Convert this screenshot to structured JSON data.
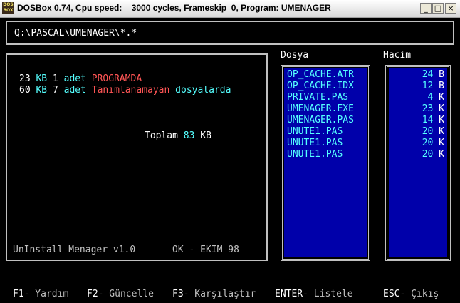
{
  "window": {
    "title": "DOSBox 0.74, Cpu speed:    3000 cycles, Frameskip  0, Program: UMENAGER",
    "icon_text": "DOS BOX",
    "min": "_",
    "max": "□",
    "close": "×"
  },
  "path": "Q:\\PASCAL\\UMENAGER\\*.*",
  "summary": {
    "line1": {
      "size": "23",
      "unit": "KB",
      "count": "1",
      "adet": "adet",
      "label": "PROGRAMDA"
    },
    "line2": {
      "size": "60",
      "unit": "KB",
      "count": "7",
      "adet": "adet",
      "label": "Tanımlanamayan",
      "suffix": "dosyalarda"
    },
    "total": {
      "label": "Toplam",
      "value": "83",
      "unit": "KB"
    },
    "footer_app": "UnInstall Menager v1.0",
    "footer_date": "OK - EKIM 98"
  },
  "headers": {
    "files": "Dosya",
    "sizes": "Hacim"
  },
  "files": [
    "OP_CACHE.ATR",
    "OP_CACHE.IDX",
    "PRIVATE.PAS",
    "UMENAGER.EXE",
    "UMENAGER.PAS",
    "UNUTE1.PAS",
    "UNUTE1.PAS",
    "UNUTE1.PAS"
  ],
  "sizes": [
    {
      "value": "24",
      "unit": "B"
    },
    {
      "value": "12",
      "unit": "B"
    },
    {
      "value": "4",
      "unit": "K"
    },
    {
      "value": "23",
      "unit": "K"
    },
    {
      "value": "14",
      "unit": "K"
    },
    {
      "value": "20",
      "unit": "K"
    },
    {
      "value": "20",
      "unit": "K"
    },
    {
      "value": "20",
      "unit": "K"
    }
  ],
  "fkeys": [
    {
      "key": "F1",
      "label": "- Yardım"
    },
    {
      "key": "F2",
      "label": "- Güncelle"
    },
    {
      "key": "F3",
      "label": "- Karşılaştır"
    },
    {
      "key": "ENTER",
      "label": "- Listele"
    },
    {
      "key": "ESC",
      "label": "- Çıkış"
    }
  ],
  "colors": {
    "list_bg": "#0000aa",
    "cyan": "#55ffff",
    "red": "#ff5555"
  }
}
